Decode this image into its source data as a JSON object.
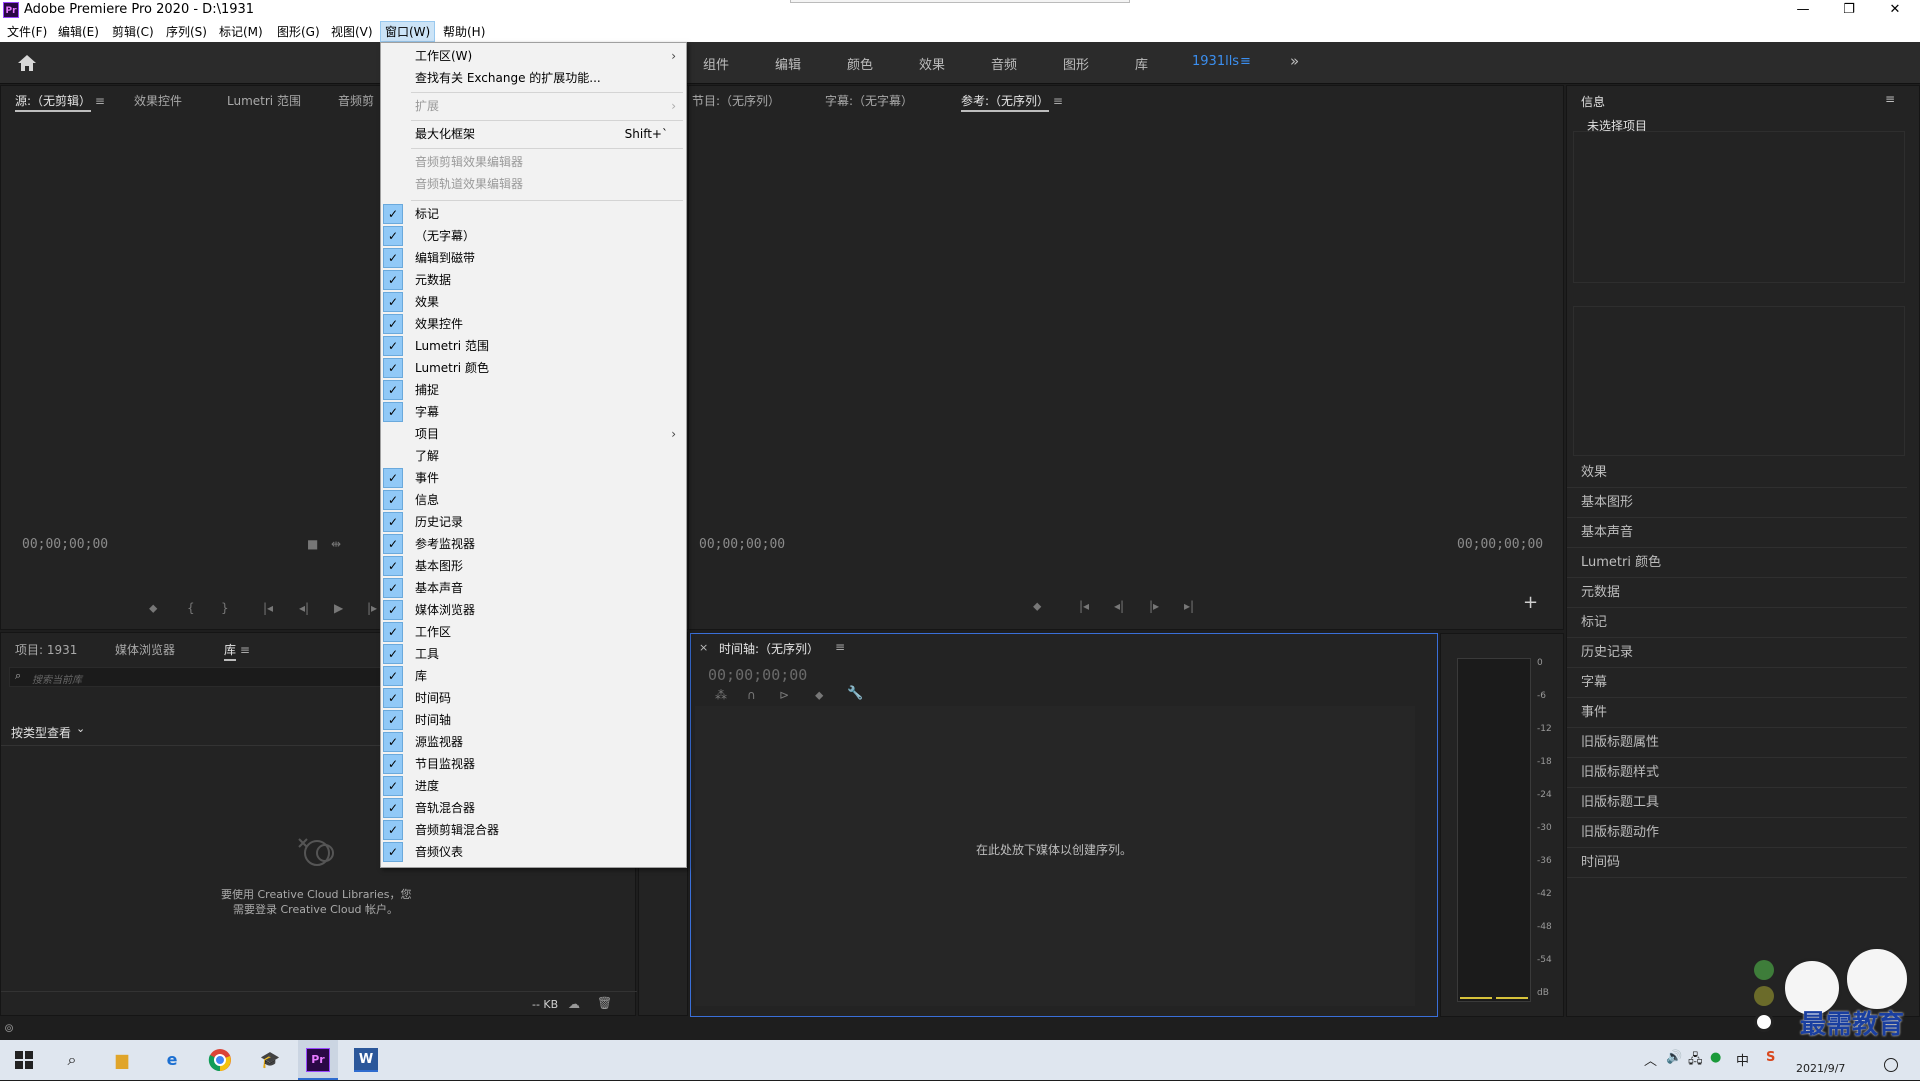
{
  "app": {
    "title": "Adobe Premiere Pro 2020 - D:\\1931",
    "logo": "Pr",
    "window_controls": {
      "minimize": "—",
      "maximize": "❐",
      "close": "✕"
    }
  },
  "menubar": [
    {
      "label": "文件(F)"
    },
    {
      "label": "编辑(E)"
    },
    {
      "label": "剪辑(C)"
    },
    {
      "label": "序列(S)"
    },
    {
      "label": "标记(M)"
    },
    {
      "label": "图形(G)"
    },
    {
      "label": "视图(V)"
    },
    {
      "label": "窗口(W)"
    },
    {
      "label": "帮助(H)"
    }
  ],
  "workspaces": [
    "组件",
    "编辑",
    "颜色",
    "效果",
    "音频",
    "图形",
    "库",
    "1931lls",
    "»"
  ],
  "window_menu": {
    "sections": [
      {
        "label": "工作区(W)",
        "submenu": true
      },
      {
        "label": "查找有关 Exchange 的扩展功能..."
      },
      {
        "label": "扩展",
        "submenu": true,
        "disabled": true
      },
      {
        "label": "最大化框架",
        "shortcut": "Shift+`"
      },
      {
        "label": "音频剪辑效果编辑器",
        "disabled": true
      },
      {
        "label": "音频轨道效果编辑器",
        "disabled": true
      }
    ],
    "items": [
      {
        "label": "标记",
        "checked": true
      },
      {
        "label": "（无字幕）",
        "checked": true
      },
      {
        "label": "编辑到磁带",
        "checked": true
      },
      {
        "label": "元数据",
        "checked": true
      },
      {
        "label": "效果",
        "checked": true
      },
      {
        "label": "效果控件",
        "checked": true
      },
      {
        "label": "Lumetri 范围",
        "checked": true
      },
      {
        "label": "Lumetri 颜色",
        "checked": true
      },
      {
        "label": "捕捉",
        "checked": true
      },
      {
        "label": "字幕",
        "checked": true
      },
      {
        "label": "项目",
        "checked": false,
        "submenu": true
      },
      {
        "label": "了解",
        "checked": false
      },
      {
        "label": "事件",
        "checked": true
      },
      {
        "label": "信息",
        "checked": true
      },
      {
        "label": "历史记录",
        "checked": true
      },
      {
        "label": "参考监视器",
        "checked": true
      },
      {
        "label": "基本图形",
        "checked": true
      },
      {
        "label": "基本声音",
        "checked": true
      },
      {
        "label": "媒体浏览器",
        "checked": true
      },
      {
        "label": "工作区",
        "checked": true
      },
      {
        "label": "工具",
        "checked": true
      },
      {
        "label": "库",
        "checked": true
      },
      {
        "label": "时间码",
        "checked": true
      },
      {
        "label": "时间轴",
        "checked": true
      },
      {
        "label": "源监视器",
        "checked": true
      },
      {
        "label": "节目监视器",
        "checked": true
      },
      {
        "label": "进度",
        "checked": true
      },
      {
        "label": "音轨混合器",
        "checked": true
      },
      {
        "label": "音频剪辑混合器",
        "checked": true
      },
      {
        "label": "音频仪表",
        "checked": true
      }
    ]
  },
  "source_panel": {
    "tabs": [
      "源:（无剪辑）",
      "效果控件",
      "Lumetri 范围",
      "音频剪"
    ],
    "timecode": "00;00;00;00"
  },
  "program_panel": {
    "tabs": [
      "节目:（无序列）",
      "字幕:（无字幕）",
      "参考:（无序列）"
    ],
    "timecode_left": "00;00;00;00",
    "timecode_right": "00;00;00;00"
  },
  "project_panel": {
    "tabs": [
      "项目: 1931",
      "媒体浏览器",
      "库"
    ],
    "search_placeholder": "搜索当前库",
    "view_by": "按类型查看",
    "cc_message_line1": "要使用 Creative Cloud Libraries，您",
    "cc_message_line2": "需要登录 Creative Cloud 帐户。",
    "size": "-- KB"
  },
  "timeline_panel": {
    "tab": "时间轴:（无序列）",
    "timecode": "00;00;00;00",
    "empty_message": "在此处放下媒体以创建序列。"
  },
  "audio_meter": {
    "scale": [
      "0",
      "-6",
      "-12",
      "-18",
      "-24",
      "-30",
      "-36",
      "-42",
      "-48",
      "-54",
      "dB"
    ]
  },
  "info_panel": {
    "title": "信息",
    "status": "未选择项目",
    "collapsed_panels": [
      "效果",
      "基本图形",
      "基本声音",
      "Lumetri 颜色",
      "元数据",
      "标记",
      "历史记录",
      "字幕",
      "事件",
      "旧版标题属性",
      "旧版标题样式",
      "旧版标题工具",
      "旧版标题动作",
      "时间码"
    ]
  },
  "taskbar": {
    "clock_date": "2021/9/7",
    "ime": "中",
    "watermark": "最需教育"
  },
  "colors": {
    "accent": "#3b8ff0",
    "check_bg": "#91c9f7",
    "timeline_border": "#3a6fd8"
  }
}
